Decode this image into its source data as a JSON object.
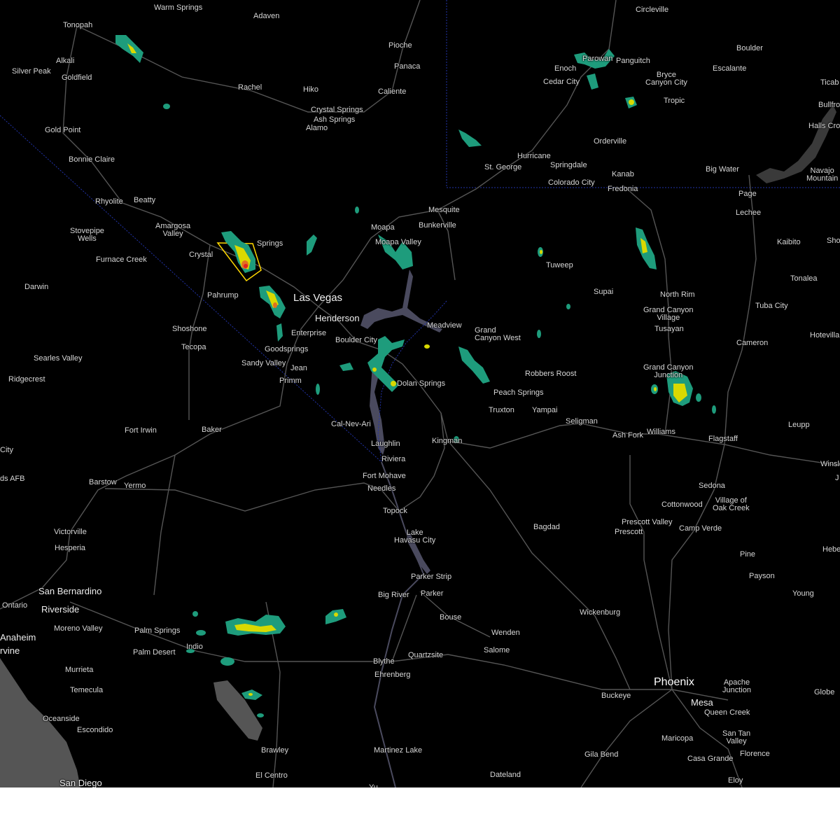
{
  "map": {
    "colors": {
      "background": "#000000",
      "roads": "#555555",
      "water": "#4a4a5e",
      "ocean": "#555555",
      "state_border": "#2233aa",
      "warning_polygon": "#ffd800",
      "radar_low": "#1e9c7c",
      "radar_mid": "#d9d900",
      "radar_high": "#e02020"
    },
    "labels": {
      "warm_springs": "Warm Springs",
      "adaven": "Adaven",
      "tonopah": "Tonopah",
      "alkali": "Alkali",
      "silver_peak": "Silver Peak",
      "goldfield": "Goldfield",
      "rachel": "Rachel",
      "hiko": "Hiko",
      "crystal_springs": "Crystal Springs",
      "ash_springs": "Ash Springs",
      "alamo": "Alamo",
      "pioche": "Pioche",
      "panaca": "Panaca",
      "caliente": "Caliente",
      "gold_point": "Gold Point",
      "bonnie_claire": "Bonnie Claire",
      "rhyolite": "Rhyolite",
      "beatty": "Beatty",
      "amargosa_valley": "Amargosa\nValley",
      "stovepipe_wells": "Stovepipe\nWells",
      "furnace_creek": "Furnace Creek",
      "crystal": "Crystal",
      "springs": "Springs",
      "darwin": "Darwin",
      "pahrump": "Pahrump",
      "las_vegas": "Las Vegas",
      "henderson": "Henderson",
      "enterprise": "Enterprise",
      "boulder_city": "Boulder City",
      "shoshone": "Shoshone",
      "tecopa": "Tecopa",
      "goodsprings": "Goodsprings",
      "sandy_valley": "Sandy Valley",
      "jean": "Jean",
      "primm": "Primm",
      "searles_valley": "Searles Valley",
      "ridgecrest": "Ridgecrest",
      "moapa": "Moapa",
      "moapa_valley": "Moapa Valley",
      "mesquite": "Mesquite",
      "bunkerville": "Bunkerville",
      "st_george": "St. George",
      "hurricane": "Hurricane",
      "springdale": "Springdale",
      "colorado_city": "Colorado City",
      "fredonia": "Fredonia",
      "kanab": "Kanab",
      "enoch": "Enoch",
      "parowan": "Parowan",
      "cedar_city": "Cedar City",
      "panguitch": "Panguitch",
      "circleville": "Circleville",
      "boulder_ut": "Boulder",
      "escalante": "Escalante",
      "bryce_canyon_city": "Bryce\nCanyon City",
      "tropic": "Tropic",
      "orderville": "Orderville",
      "big_water": "Big Water",
      "page": "Page",
      "lechee": "Lechee",
      "navajo_mountain": "Navajo\nMountain",
      "ticaboo": "Ticab",
      "bullfrog": "Bullfro",
      "halls_crossing": "Halls Cro",
      "kaibito": "Kaibito",
      "shonto": "Sho",
      "tonalea": "Tonalea",
      "tuba_city": "Tuba City",
      "hotevilla": "Hotevilla",
      "cameron": "Cameron",
      "north_rim": "North Rim",
      "grand_canyon_village": "Grand Canyon\nVillage",
      "tusayan": "Tusayan",
      "tuweep": "Tuweep",
      "supai": "Supai",
      "meadview": "Meadview",
      "grand_canyon_west": "Grand\nCanyon West",
      "dolan_springs": "Dolan Springs",
      "robbers_roost": "Robbers Roost",
      "peach_springs": "Peach Springs",
      "truxton": "Truxton",
      "yampai": "Yampai",
      "seligman": "Seligman",
      "ash_fork": "Ash Fork",
      "williams": "Williams",
      "flagstaff": "Flagstaff",
      "leupp": "Leupp",
      "grand_canyon_junction": "Grand Canyon\nJunction",
      "winslow": "Winslo",
      "joseph_city": "J",
      "sedona": "Sedona",
      "village_of_oak_creek": "Village of\nOak Creek",
      "cottonwood": "Cottonwood",
      "camp_verde": "Camp Verde",
      "prescott_valley": "Prescott Valley",
      "prescott": "Prescott",
      "bagdad": "Bagdad",
      "pine": "Pine",
      "payson": "Payson",
      "heber": "Hebe",
      "young": "Young",
      "kingman": "Kingman",
      "cal_nev_ari": "Cal-Nev-Ari",
      "laughlin": "Laughlin",
      "riviera": "Riviera",
      "fort_mohave": "Fort Mohave",
      "needles": "Needles",
      "topock": "Topock",
      "lake_havasu_city": "Lake\nHavasu City",
      "parker_strip": "Parker Strip",
      "parker": "Parker",
      "big_river": "Big River",
      "bouse": "Bouse",
      "wenden": "Wenden",
      "salome": "Salome",
      "wickenburg": "Wickenburg",
      "quartzsite": "Quartzsite",
      "blythe": "Blythe",
      "ehrenberg": "Ehrenberg",
      "phoenix": "Phoenix",
      "mesa": "Mesa",
      "apache_junction": "Apache\nJunction",
      "globe": "Globe",
      "queen_creek": "Queen Creek",
      "san_tan_valley": "San Tan\nValley",
      "florence": "Florence",
      "maricopa": "Maricopa",
      "casa_grande": "Casa Grande",
      "buckeye": "Buckeye",
      "gila_bend": "Gila Bend",
      "eloy": "Eloy",
      "dateland": "Dateland",
      "martinez_lake": "Martinez Lake",
      "yuma": "Yu",
      "el_centro": "El Centro",
      "brawley": "Brawley",
      "fort_irwin": "Fort Irwin",
      "baker": "Baker",
      "barstow": "Barstow",
      "yermo": "Yermo",
      "edwards_afb": "ds AFB",
      "california_city": "City",
      "victorville": "Victorville",
      "hesperia": "Hesperia",
      "san_bernardino": "San Bernardino",
      "ontario": "Ontario",
      "riverside": "Riverside",
      "moreno_valley": "Moreno Valley",
      "anaheim": "Anaheim",
      "irvine": "rvine",
      "palm_springs": "Palm Springs",
      "palm_desert": "Palm Desert",
      "indio": "Indio",
      "murrieta": "Murrieta",
      "temecula": "Temecula",
      "oceanside": "Oceanside",
      "escondido": "Escondido",
      "san_diego": "San Diego"
    }
  }
}
